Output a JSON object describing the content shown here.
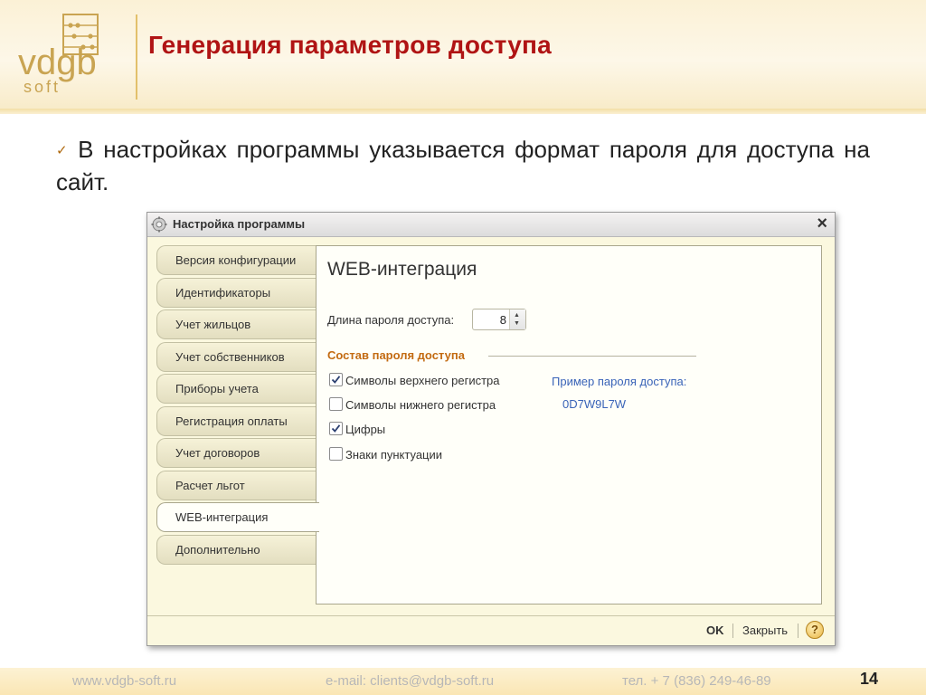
{
  "slide": {
    "title": "Генерация параметров доступа",
    "bullet": "В настройках программы указывается формат пароля для доступа на сайт.",
    "page_number": "14"
  },
  "logo": {
    "top": "vdgb",
    "bottom": "soft"
  },
  "dialog": {
    "title": "Настройка программы",
    "tabs": [
      {
        "label": "Версия конфигурации"
      },
      {
        "label": "Идентификаторы"
      },
      {
        "label": "Учет жильцов"
      },
      {
        "label": "Учет собственников"
      },
      {
        "label": "Приборы учета"
      },
      {
        "label": "Регистрация оплаты"
      },
      {
        "label": "Учет договоров"
      },
      {
        "label": "Расчет льгот"
      },
      {
        "label": "WEB-интеграция",
        "active": true
      },
      {
        "label": "Дополнительно"
      }
    ],
    "content": {
      "section_title": "WEB-интеграция",
      "password_length_label": "Длина пароля доступа:",
      "password_length_value": "8",
      "group_title": "Состав пароля доступа",
      "options": [
        {
          "label": "Символы верхнего регистра",
          "checked": true
        },
        {
          "label": "Символы нижнего регистра",
          "checked": false
        },
        {
          "label": "Цифры",
          "checked": true
        },
        {
          "label": "Знаки пунктуации",
          "checked": false
        }
      ],
      "example_label": "Пример пароля доступа:",
      "example_value": "0D7W9L7W"
    },
    "buttons": {
      "ok": "OK",
      "close": "Закрыть",
      "help": "?"
    }
  },
  "footer": {
    "website": "www.vdgb-soft.ru",
    "email": "e-mail: clients@vdgb-soft.ru",
    "phone": "тел. + 7 (836) 249-46-89"
  },
  "colors": {
    "title": "#b01414",
    "group_title": "#c36b12",
    "example_text": "#3a64b8",
    "dialog_bg": "#fbf8df"
  }
}
